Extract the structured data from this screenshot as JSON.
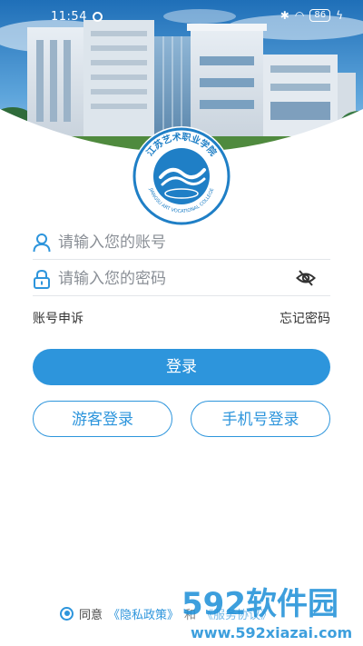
{
  "status_bar": {
    "time": "11:54",
    "battery": "86"
  },
  "school": {
    "logo_text_top": "江苏艺术职业学院",
    "logo_text_bottom": "JIANGSU ART VOCATIONAL COLLEGE"
  },
  "form": {
    "account_placeholder": "请输入您的账号",
    "password_placeholder": "请输入您的密码",
    "appeal_label": "账号申诉",
    "forgot_label": "忘记密码"
  },
  "buttons": {
    "login": "登录",
    "guest_login": "游客登录",
    "phone_login": "手机号登录"
  },
  "agreement": {
    "prefix": "同意",
    "privacy_link": "《隐私政策》",
    "conjunction": "和",
    "service_link": "《服务协议》"
  },
  "watermark": {
    "brand": "592软件园",
    "url": "www.592xiazai.com"
  },
  "colors": {
    "accent": "#2d95dc",
    "logo_ring": "#1f7fc6"
  },
  "icons": {
    "account": "user-icon",
    "password": "lock-icon",
    "visibility": "eye-off-icon",
    "agree": "radio-checked-icon"
  }
}
